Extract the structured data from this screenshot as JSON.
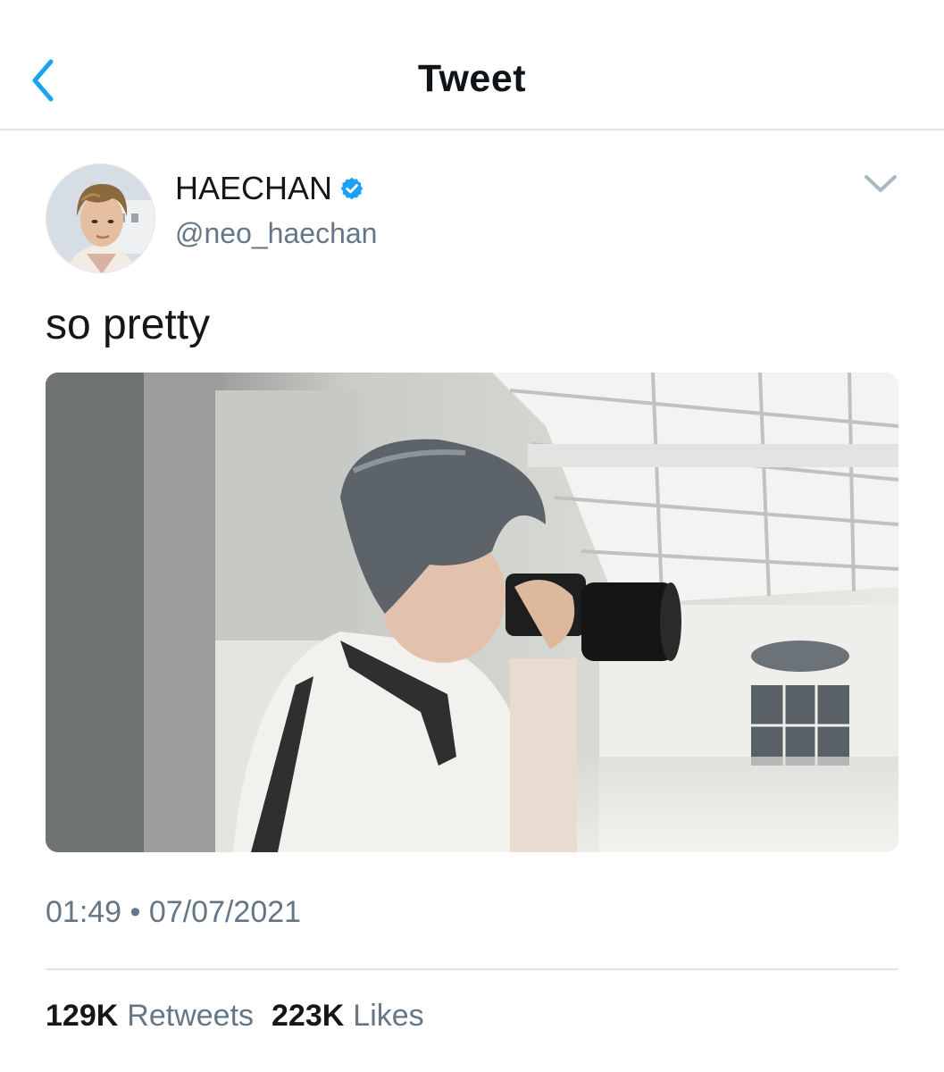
{
  "header": {
    "title": "Tweet",
    "back_icon": "chevron-left-icon"
  },
  "tweet": {
    "author": {
      "display_name": "HAECHAN",
      "handle": "@neo_haechan",
      "verified_icon": "verified-badge-icon"
    },
    "text": "so pretty",
    "time": "01:49",
    "separator": "•",
    "date": "07/07/2021",
    "stats": {
      "retweets_count": "129K",
      "retweets_label": "Retweets",
      "likes_count": "223K",
      "likes_label": "Likes"
    }
  },
  "colors": {
    "accent": "#1da1f2",
    "secondary_text": "#657786",
    "divider": "#e1e4e8"
  }
}
